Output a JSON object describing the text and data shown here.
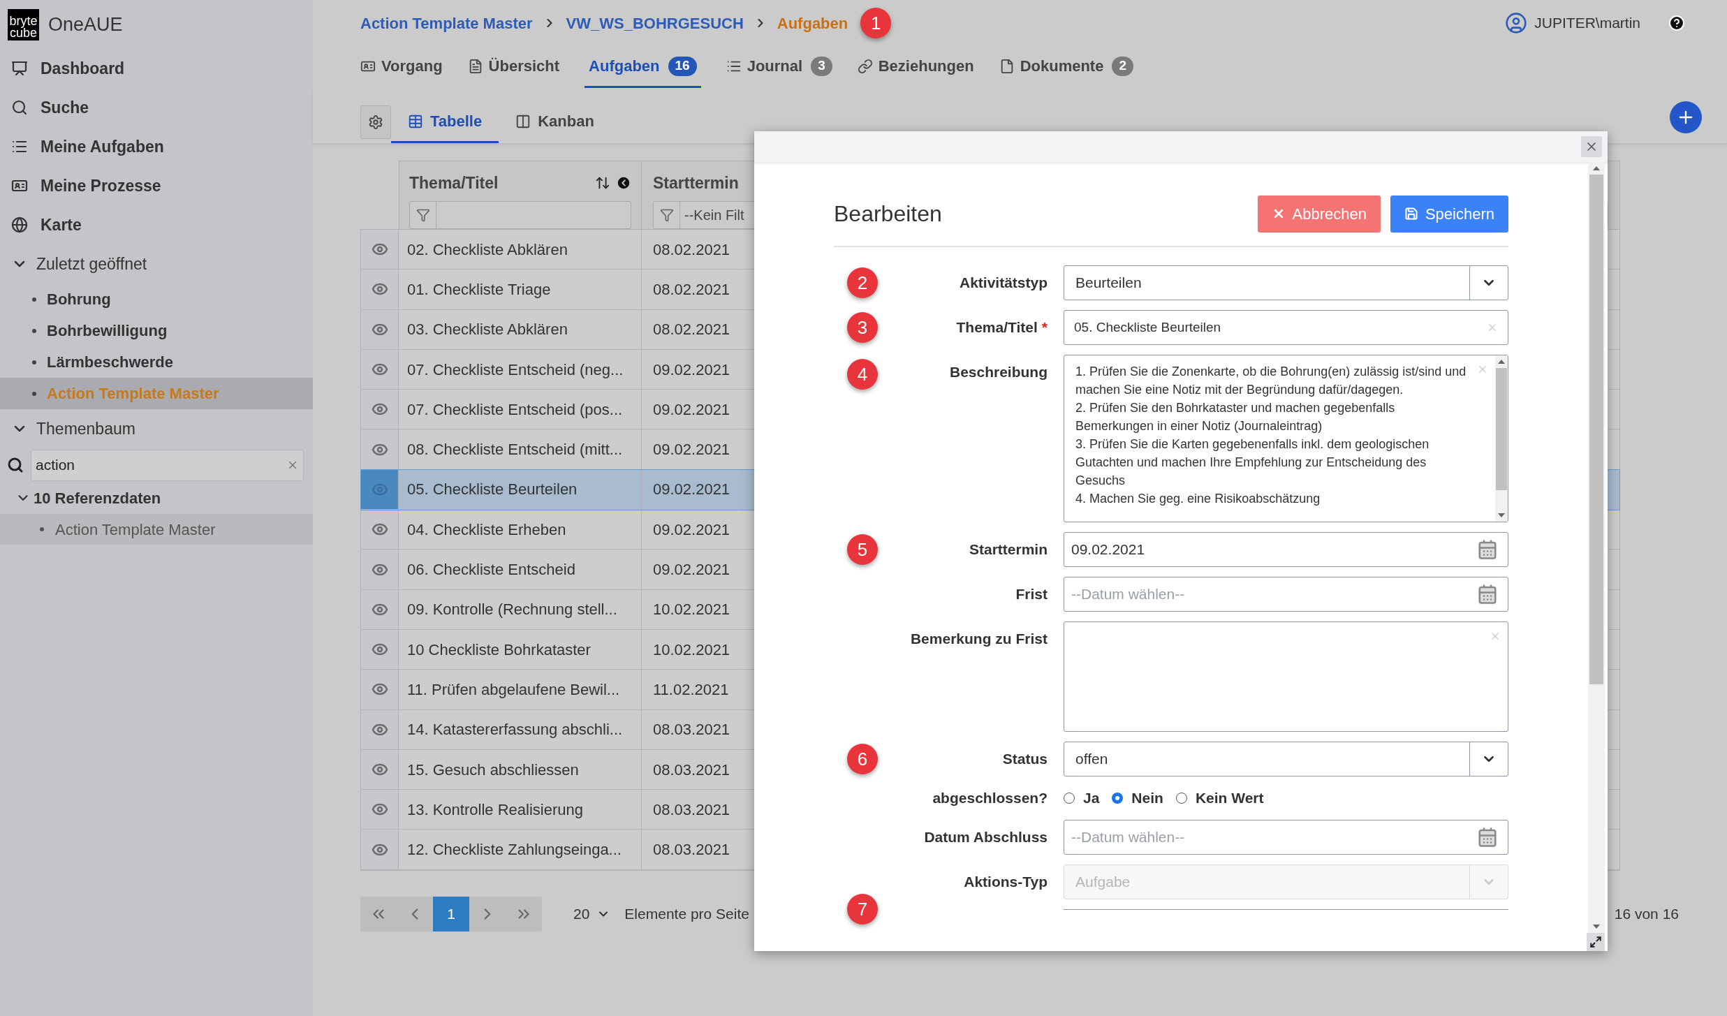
{
  "app": {
    "logo_lines": [
      "bryte",
      "cube"
    ],
    "name": "OneAUE"
  },
  "sidebar": {
    "nav": [
      {
        "label": "Dashboard"
      },
      {
        "label": "Suche"
      },
      {
        "label": "Meine Aufgaben"
      },
      {
        "label": "Meine Prozesse"
      },
      {
        "label": "Karte"
      }
    ],
    "recent": {
      "label": "Zuletzt geöffnet",
      "expanded": true,
      "items": [
        {
          "label": "Bohrung",
          "selected": false
        },
        {
          "label": "Bohrbewilligung",
          "selected": false
        },
        {
          "label": "Lärmbeschwerde",
          "selected": false
        },
        {
          "label": "Action Template Master",
          "selected": true
        }
      ]
    },
    "tree": {
      "label": "Themenbaum",
      "expanded": true,
      "search": {
        "value": "action"
      },
      "nodes": [
        {
          "label": "10 Referenzdaten",
          "expanded": true,
          "children": [
            {
              "label": "Action Template Master",
              "selected": true
            }
          ]
        }
      ]
    }
  },
  "breadcrumb": [
    {
      "label": "Action Template Master",
      "current": false
    },
    {
      "label": "VW_WS_BOHRGESUCH",
      "current": false
    },
    {
      "label": "Aufgaben",
      "current": true
    }
  ],
  "breadcrumb_badge": "1",
  "user": "JUPITER\\martin",
  "tabs": [
    {
      "label": "Vorgang",
      "selected": false
    },
    {
      "label": "Übersicht",
      "selected": false
    },
    {
      "label": "Aufgaben",
      "count": "16",
      "selected": true
    },
    {
      "label": "Journal",
      "count": "3",
      "selected": false
    },
    {
      "label": "Beziehungen",
      "selected": false
    },
    {
      "label": "Dokumente",
      "count": "2",
      "selected": false
    }
  ],
  "view_tabs": [
    {
      "label": "Tabelle",
      "selected": true
    },
    {
      "label": "Kanban",
      "selected": false
    }
  ],
  "table": {
    "columns": [
      {
        "label": "Thema/Titel"
      },
      {
        "label": "Starttermin",
        "filter_placeholder": "--Kein Filt"
      }
    ],
    "rows": [
      {
        "title": "02. Checkliste Abklären",
        "start": "08.02.2021",
        "selected": false
      },
      {
        "title": "01. Checkliste Triage",
        "start": "08.02.2021",
        "selected": false
      },
      {
        "title": "03. Checkliste Abklären",
        "start": "08.02.2021",
        "selected": false
      },
      {
        "title": "07. Checkliste Entscheid (neg...",
        "start": "09.02.2021",
        "selected": false
      },
      {
        "title": "07. Checkliste Entscheid (pos...",
        "start": "09.02.2021",
        "selected": false
      },
      {
        "title": "08. Checkliste Entscheid (mitt...",
        "start": "09.02.2021",
        "selected": false
      },
      {
        "title": "05. Checkliste Beurteilen",
        "start": "09.02.2021",
        "selected": true
      },
      {
        "title": "04. Checkliste Erheben",
        "start": "09.02.2021",
        "selected": false
      },
      {
        "title": "06. Checkliste Entscheid",
        "start": "09.02.2021",
        "selected": false
      },
      {
        "title": "09. Kontrolle (Rechnung stell...",
        "start": "10.02.2021",
        "selected": false
      },
      {
        "title": "10 Checkliste Bohrkataster",
        "start": "10.02.2021",
        "selected": false
      },
      {
        "title": "11. Prüfen abgelaufene Bewil...",
        "start": "11.02.2021",
        "selected": false
      },
      {
        "title": "14. Katastererfassung abschli...",
        "start": "08.03.2021",
        "selected": false
      },
      {
        "title": "15. Gesuch abschliessen",
        "start": "08.03.2021",
        "selected": false
      },
      {
        "title": "13. Kontrolle Realisierung",
        "start": "08.03.2021",
        "selected": false
      },
      {
        "title": "12. Checkliste Zahlungseinga...",
        "start": "08.03.2021",
        "selected": false
      }
    ]
  },
  "pagination": {
    "pages": [
      {
        "label": "1",
        "selected": true
      }
    ],
    "page_size": "20",
    "page_size_label": "Elemente pro Seite",
    "summary": "16 von 16"
  },
  "dialog": {
    "title": "Bearbeiten",
    "buttons": [
      {
        "label": "Abbrechen",
        "kind": "cancel"
      },
      {
        "label": "Speichern",
        "kind": "save"
      }
    ],
    "fields": [
      {
        "kind": "select",
        "badge": "2",
        "label": "Aktivitätstyp",
        "value": "Beurteilen",
        "disabled": false
      },
      {
        "kind": "text",
        "badge": "3",
        "label": "Thema/Titel",
        "required_mark": "*",
        "value": "05. Checkliste Beurteilen"
      },
      {
        "kind": "textarea",
        "badge": "4",
        "label": "Beschreibung",
        "value": "1. Prüfen Sie die Zonenkarte, ob die Bohrung(en) zulässig ist/sind und machen Sie eine Notiz mit der Begründung dafür/dagegen.\n2. Prüfen Sie den Bohrkataster und machen gegebenfalls Bemerkungen in einer Notiz (Journaleintrag)\n3. Prüfen Sie die Karten gegebenenfalls inkl. dem geologischen Gutachten und machen Ihre Empfehlung zur Entscheidung des Gesuchs\n4. Machen Sie geg. eine Risikoabschätzung"
      },
      {
        "kind": "date",
        "badge": "5",
        "label": "Starttermin",
        "value": "09.02.2021"
      },
      {
        "kind": "date",
        "label": "Frist",
        "placeholder": "--Datum wählen--"
      },
      {
        "kind": "textarea",
        "label": "Bemerkung zu Frist"
      },
      {
        "kind": "select",
        "badge": "6",
        "label": "Status",
        "value": "offen",
        "disabled": false
      },
      {
        "kind": "radio",
        "label": "abgeschlossen?",
        "options": [
          {
            "label": "Ja",
            "selected": false
          },
          {
            "label": "Nein",
            "selected": true
          },
          {
            "label": "Kein Wert",
            "selected": false
          }
        ]
      },
      {
        "kind": "date",
        "label": "Datum Abschluss",
        "placeholder": "--Datum wählen--"
      },
      {
        "kind": "select",
        "label": "Aktions-Typ",
        "value": "Aufgabe",
        "disabled": true
      },
      {
        "kind": "partial",
        "badge": "7"
      }
    ]
  }
}
